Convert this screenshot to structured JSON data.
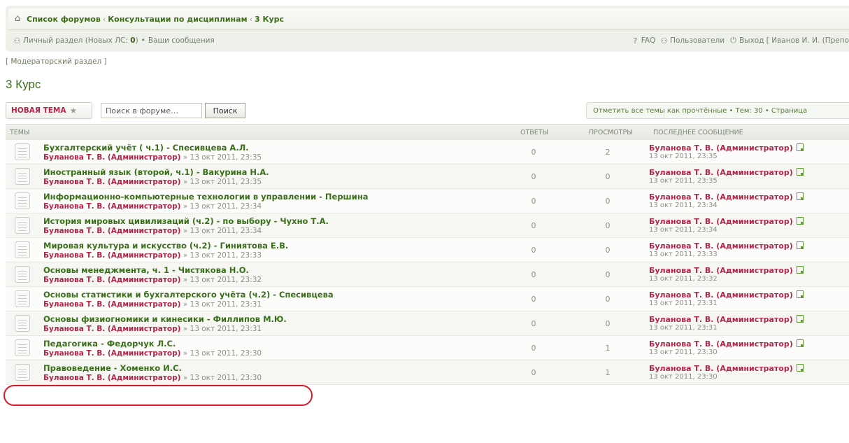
{
  "navbar": {
    "breadcrumbs": [
      "Список форумов",
      "Консультации по дисциплинам",
      "3 Курс"
    ],
    "breadcrumb_sep": "‹",
    "personal_section": "Личный раздел (Новых ЛС: ",
    "new_pm_count": "0",
    "personal_section_close": ")",
    "bullet": "•",
    "your_posts": "Ваши сообщения",
    "faq": "FAQ",
    "users": "Пользователи",
    "logout": "Выход [ Иванов И. И. (Препо"
  },
  "moderator_link": "[ Модераторский раздел ]",
  "page_title": "3 Курс",
  "actions": {
    "new_topic": "НОВАЯ ТЕМА",
    "search_value": "Поиск в форуме…",
    "search_button": "Поиск",
    "pagination": "Отметить все темы как прочтённые • Тем: 30 • Страница"
  },
  "table": {
    "headers": {
      "topics": "Темы",
      "replies": "Ответы",
      "views": "Просмотры",
      "last_post": "Последнее сообщение"
    },
    "rows": [
      {
        "title": "Бухгалтерский учёт ( ч.1) - Спесивцева А.Л.",
        "author": "Буланова Т. В. (Администратор)",
        "meta": " » 13 окт 2011, 23:35",
        "replies": "0",
        "views": "2",
        "last_author": "Буланова Т. В. (Администратор)",
        "last_time": "13 окт 2011, 23:35"
      },
      {
        "title": "Иностранный язык (второй, ч.1) - Вакурина Н.А.",
        "author": "Буланова Т. В. (Администратор)",
        "meta": " » 13 окт 2011, 23:35",
        "replies": "0",
        "views": "0",
        "last_author": "Буланова Т. В. (Администратор)",
        "last_time": "13 окт 2011, 23:35"
      },
      {
        "title": "Информационно-компьютерные технологии в управлении - Першина",
        "author": "Буланова Т. В. (Администратор)",
        "meta": " » 13 окт 2011, 23:34",
        "replies": "0",
        "views": "0",
        "last_author": "Буланова Т. В. (Администратор)",
        "last_time": "13 окт 2011, 23:34"
      },
      {
        "title": "История мировых цивилизаций (ч.2) - по выбору - Чухно Т.А.",
        "author": "Буланова Т. В. (Администратор)",
        "meta": " » 13 окт 2011, 23:34",
        "replies": "0",
        "views": "0",
        "last_author": "Буланова Т. В. (Администратор)",
        "last_time": "13 окт 2011, 23:34"
      },
      {
        "title": "Мировая культура и искусство (ч.2) - Гиниятова Е.В.",
        "author": "Буланова Т. В. (Администратор)",
        "meta": " » 13 окт 2011, 23:33",
        "replies": "0",
        "views": "0",
        "last_author": "Буланова Т. В. (Администратор)",
        "last_time": "13 окт 2011, 23:33"
      },
      {
        "title": "Основы менеджмента, ч. 1 - Чистякова Н.О.",
        "author": "Буланова Т. В. (Администратор)",
        "meta": " » 13 окт 2011, 23:32",
        "replies": "0",
        "views": "0",
        "last_author": "Буланова Т. В. (Администратор)",
        "last_time": "13 окт 2011, 23:32"
      },
      {
        "title": "Основы статистики и бухгалтерского учёта (ч.2) - Спесивцева",
        "author": "Буланова Т. В. (Администратор)",
        "meta": " » 13 окт 2011, 23:31",
        "replies": "0",
        "views": "0",
        "last_author": "Буланова Т. В. (Администратор)",
        "last_time": "13 окт 2011, 23:31"
      },
      {
        "title": "Основы физиогномики и кинесики - Филлипов М.Ю.",
        "author": "Буланова Т. В. (Администратор)",
        "meta": " » 13 окт 2011, 23:31",
        "replies": "0",
        "views": "0",
        "last_author": "Буланова Т. В. (Администратор)",
        "last_time": "13 окт 2011, 23:31"
      },
      {
        "title": "Педагогика - Федорчук Л.С.",
        "author": "Буланова Т. В. (Администратор)",
        "meta": " » 13 окт 2011, 23:30",
        "replies": "0",
        "views": "1",
        "last_author": "Буланова Т. В. (Администратор)",
        "last_time": "13 окт 2011, 23:30"
      },
      {
        "title": "Правоведение - Хоменко И.С.",
        "author": "Буланова Т. В. (Администратор)",
        "meta": " » 13 окт 2011, 23:30",
        "replies": "0",
        "views": "1",
        "last_author": "Буланова Т. В. (Администратор)",
        "last_time": "13 окт 2011, 23:30"
      }
    ]
  },
  "colors": {
    "link_green": "#3a6f1a",
    "author_red": "#b3264a",
    "highlight": "#d7192a"
  }
}
